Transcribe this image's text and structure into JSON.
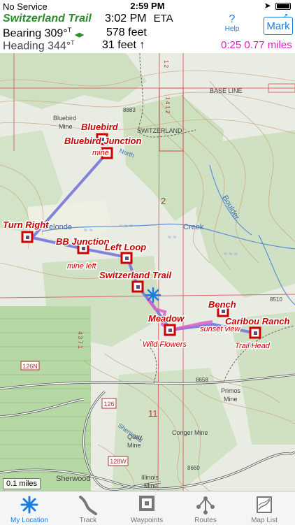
{
  "status": {
    "carrier": "No Service",
    "time": "2:59 PM"
  },
  "header": {
    "trail_name": "Switzerland Trail",
    "eta_time": "3:02 PM",
    "eta_label": "ETA",
    "bearing": "Bearing  309°",
    "bearing_suffix": "T",
    "heading": "Heading 344°",
    "heading_suffix": "T",
    "dist1": "578 feet",
    "dist2": "31 feet",
    "help": "Help",
    "mark": "Mark",
    "stats": "0:25  0.77 miles"
  },
  "map_labels": {
    "base_line": "BASE LINE",
    "bluebird_mine": "Bluebird\nMine",
    "elev1": "8883",
    "switzerland": "SWITZERLAND",
    "north": "North",
    "two": "2",
    "delonde": "Delonde",
    "creek": "Creek",
    "boulder": "Boulder",
    "elev2": "8510",
    "elev3": "8658",
    "primos": "Primos\nMine",
    "eleven": "11",
    "conger": "Conger Mine",
    "sherwood": "Sherwood",
    "quay": "Quay\nMine",
    "illinois": "Illinois\nMine",
    "elev4": "8660",
    "r126n": "126N",
    "r126": "126",
    "r128w": "128W",
    "sherwood2": "Sherwood"
  },
  "waypoints": [
    {
      "title": "Bluebird",
      "sub": ""
    },
    {
      "title": "Bluebird Junction",
      "sub": "mine"
    },
    {
      "title": "Turn Right",
      "sub": ""
    },
    {
      "title": "BB Junction",
      "sub": "mine left"
    },
    {
      "title": "Left Loop",
      "sub": ""
    },
    {
      "title": "Switzerland Trail",
      "sub": ""
    },
    {
      "title": "Meadow",
      "sub": "Wild Flowers"
    },
    {
      "title": "Bench",
      "sub": "sunset view"
    },
    {
      "title": "Caribou Ranch",
      "sub": "Trail Head"
    }
  ],
  "scale": "0.1 miles",
  "tabs": [
    {
      "label": "My Location",
      "icon": "snowflake-icon"
    },
    {
      "label": "Track",
      "icon": "track-icon"
    },
    {
      "label": "Waypoints",
      "icon": "waypoints-icon"
    },
    {
      "label": "Routes",
      "icon": "routes-icon"
    },
    {
      "label": "Map List",
      "icon": "map-list-icon"
    }
  ],
  "colors": {
    "accent": "#1a7ee0",
    "trail_green": "#2e8b2e",
    "stats_magenta": "#d91ec4",
    "waypoint_red": "#cc0000"
  }
}
